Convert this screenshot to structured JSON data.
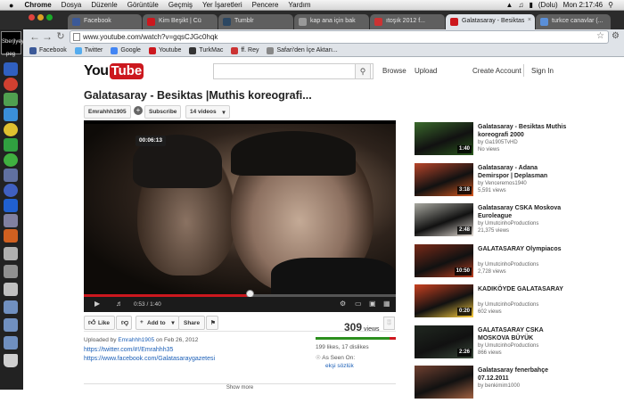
{
  "menubar": {
    "apple": "",
    "app": "Chrome",
    "items": [
      "Dosya",
      "Düzenle",
      "Görüntüle",
      "Geçmiş",
      "Yer İşaretleri",
      "Pencere",
      "Yardım"
    ],
    "battery": "(Dolu)",
    "clock": "Mon 2:17:46"
  },
  "tabs": [
    {
      "label": "Facebook",
      "color": "#3b5998"
    },
    {
      "label": "Kim Beşikt | Cü",
      "color": "#cc181e"
    },
    {
      "label": "Tumblr",
      "color": "#2c4762"
    },
    {
      "label": "kap ana için bak",
      "color": "#999999"
    },
    {
      "label": "ıtoşık 2012 f...",
      "color": "#cc3333"
    },
    {
      "label": "Galatasaray - Besiktas",
      "color": "#cc181e"
    },
    {
      "label": "turkce canavlar (...",
      "color": "#5a8fd8"
    }
  ],
  "omnibox": {
    "url": "www.youtube.com/watch?v=gqsCJGc0hqk"
  },
  "bookmarks": [
    {
      "label": "Facebook",
      "color": "#3b5998"
    },
    {
      "label": "Twitter",
      "color": "#55acee"
    },
    {
      "label": "Google",
      "color": "#4285f4"
    },
    {
      "label": "Youtube",
      "color": "#cc181e"
    },
    {
      "label": "TurkMac",
      "color": "#333333"
    },
    {
      "label": "ff. Rey",
      "color": "#cc3333"
    },
    {
      "label": "Safari'den İçe Aktarı...",
      "color": "#888888"
    }
  ],
  "dock": {
    "thumb_label": "Sberjlyey",
    "thumb_label2": "...peg"
  },
  "youtube": {
    "logo_you": "You",
    "logo_tube": "Tube",
    "search_placeholder": "",
    "browse": "Browse",
    "upload": "Upload",
    "create_account": "Create Account",
    "sign_in": "Sign In"
  },
  "video": {
    "title": "Galatasaray - Besiktas |Muthis koreografi...",
    "channel": "Emrahhh1905",
    "subscribe": "Subscribe",
    "videos_count": "14 videos",
    "timestamp_overlay": "00:06:13",
    "time_current": "0:53",
    "time_total": "1:40",
    "progress": 0.53,
    "like": "Like",
    "add_to": "Add to",
    "share": "Share",
    "views_count": "309",
    "views_label": "views",
    "likes_text": "199 likes, 17 dislikes",
    "like_ratio": 0.92,
    "uploaded_by_prefix": "Uploaded by",
    "uploader": "Emrahhh1905",
    "upload_date": "on Feb 26, 2012",
    "desc_link1": "https://twitter.com/#!/Emrahhh35",
    "desc_link2": "https://www.facebook.com/Galatasaraygazetesi",
    "as_seen_on": "As Seen On:",
    "seen_source": "ekşi sözlük",
    "show_more": "Show more"
  },
  "related": [
    {
      "title": "Galatasaray - Besiktas Muthis koreografi 2000",
      "by": "by Ga1905TvHD",
      "views": "No views",
      "duration": "1:40",
      "thumb": "#3a6a2c"
    },
    {
      "title": "Galatasaray - Adana Demirspor | Deplasman",
      "by": "by Venceremos1940",
      "views": "5,591 views",
      "duration": "3:18",
      "thumb": "#b8452a"
    },
    {
      "title": "Galatasaray CSKA Moskova Euroleague",
      "by": "by UmutcinhoProductions",
      "views": "21,375 views",
      "duration": "2:48",
      "thumb": "#a8a8a0"
    },
    {
      "title": "GALATASARAY Olympiacos",
      "by": "by UmutcinhoProductions",
      "views": "2,728 views",
      "duration": "10:50",
      "thumb": "#7a2a18"
    },
    {
      "title": "KADIKÖYDE GALATASARAY",
      "by": "by UmutcinhoProductions",
      "views": "602 views",
      "duration": "0:20",
      "thumb": "#c84020"
    },
    {
      "title": "GALATASARAY CSKA MOSKOVA BÜYÜK",
      "by": "by UmutcinhoProductions",
      "views": "866 views",
      "duration": "2:26",
      "thumb": "#202820"
    },
    {
      "title": "Galatasaray fenerbahçe 07.12.2011",
      "by": "by benkimim1000",
      "views": "",
      "duration": "",
      "thumb": "#704030"
    }
  ]
}
